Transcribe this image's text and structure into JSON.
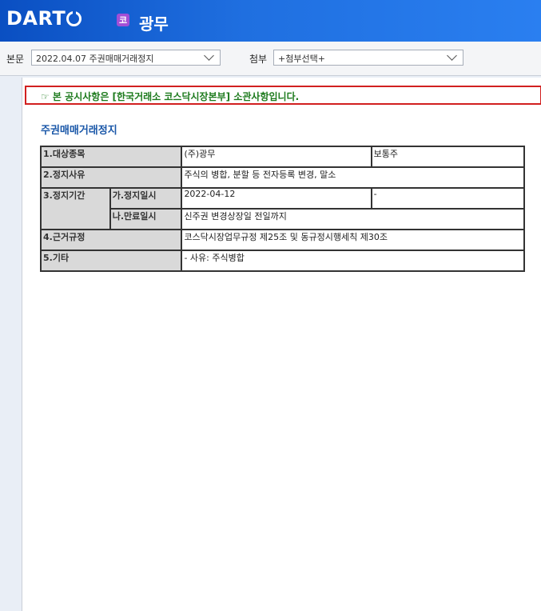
{
  "header": {
    "logo_text": "DART",
    "company_badge": "코",
    "company_name": "광무"
  },
  "toolbar": {
    "body_label": "본문",
    "body_select_value": "2022.04.07  주권매매거래정지",
    "attach_label": "첨부",
    "attach_select_value": "+첨부선택+"
  },
  "notice": "☞ 본 공시사항은 [한국거래소 코스닥시장본부] 소관사항입니다.",
  "doc_title": "주권매매거래정지",
  "table": {
    "r1_label": "1.대상종목",
    "r1_value": "(주)광무",
    "r1_type": "보통주",
    "r2_label": "2.정지사유",
    "r2_value": "주식의 병합, 분할 등 전자등록 변경, 말소",
    "r3_label": "3.정지기간",
    "r3a_label": "가.정지일시",
    "r3a_value": "2022-04-12",
    "r3a_extra": "-",
    "r3b_label": "나.만료일시",
    "r3b_value": "신주권 변경상장일 전일까지",
    "r4_label": "4.근거규정",
    "r4_value": "코스닥시장업무규정 제25조 및 동규정시행세칙 제30조",
    "r5_label": "5.기타",
    "r5_value": "- 사유: 주식병합"
  }
}
